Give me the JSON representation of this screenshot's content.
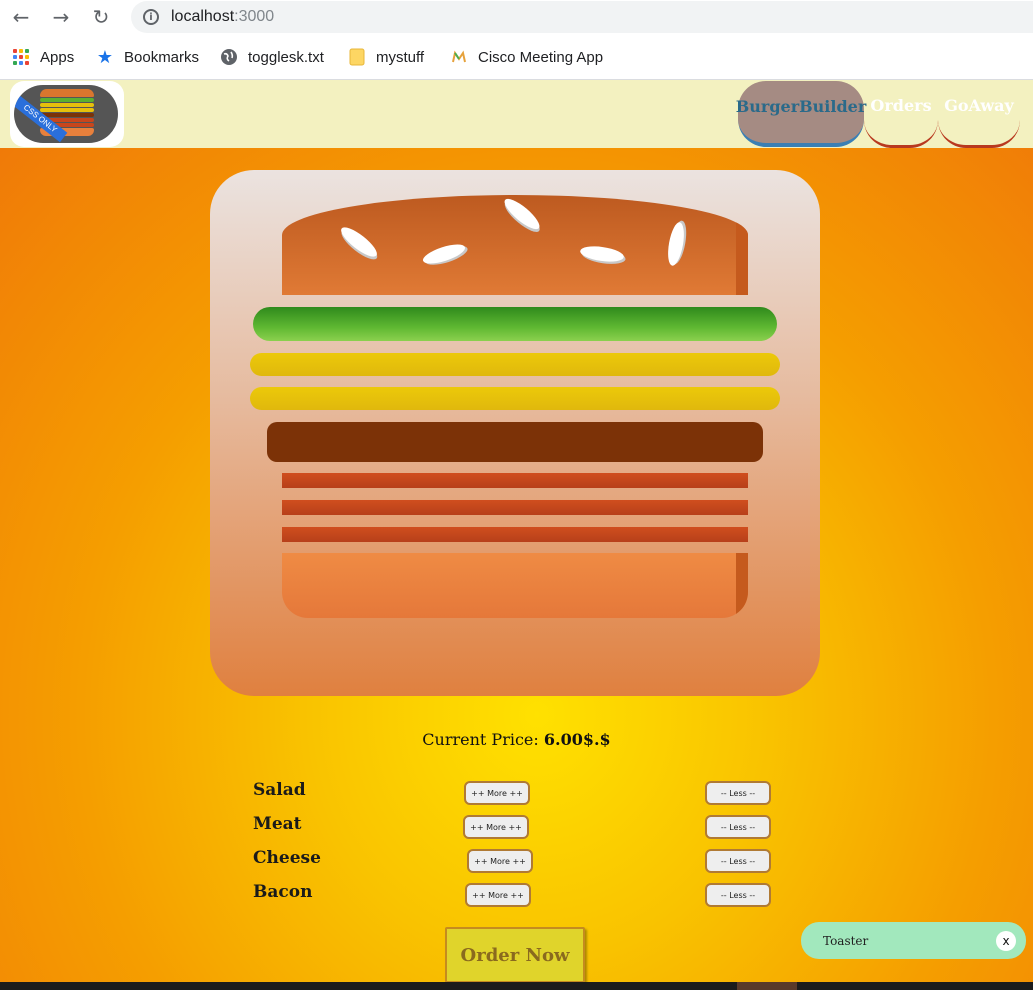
{
  "browser": {
    "url_host": "localhost",
    "url_port": ":3000",
    "bookmarks": [
      {
        "label": "Apps",
        "icon": "apps-grid-icon"
      },
      {
        "label": "Bookmarks",
        "icon": "star-icon"
      },
      {
        "label": "togglesk.txt",
        "icon": "globe-icon"
      },
      {
        "label": "mystuff",
        "icon": "folder-icon"
      },
      {
        "label": "Cisco Meeting App",
        "icon": "cisco-icon"
      }
    ]
  },
  "header": {
    "logo_ribbon": "CSS ONLY",
    "nav": [
      {
        "label": "BurgerBuilder",
        "active": true
      },
      {
        "label": "Orders",
        "active": false
      },
      {
        "label": "GoAway",
        "active": false
      }
    ]
  },
  "burger": {
    "layers": [
      "salad",
      "cheese",
      "cheese",
      "meat",
      "bacon",
      "bacon",
      "bacon"
    ]
  },
  "price": {
    "label": "Current Price:",
    "value": "6.00$.$"
  },
  "controls": [
    {
      "label": "Salad",
      "more": "++ More ++",
      "less": "-- Less --"
    },
    {
      "label": "Meat",
      "more": "++ More ++",
      "less": "-- Less --"
    },
    {
      "label": "Cheese",
      "more": "++ More ++",
      "less": "-- Less --"
    },
    {
      "label": "Bacon",
      "more": "++ More ++",
      "less": "-- Less --"
    }
  ],
  "order_button": "Order Now",
  "toaster": {
    "text": "Toaster",
    "close": "x"
  },
  "colors": {
    "header_bg": "#f3f1c0",
    "active_tab": "#a58b83",
    "toaster_bg": "#a2e8bd",
    "order_btn": "#e0d42b"
  }
}
